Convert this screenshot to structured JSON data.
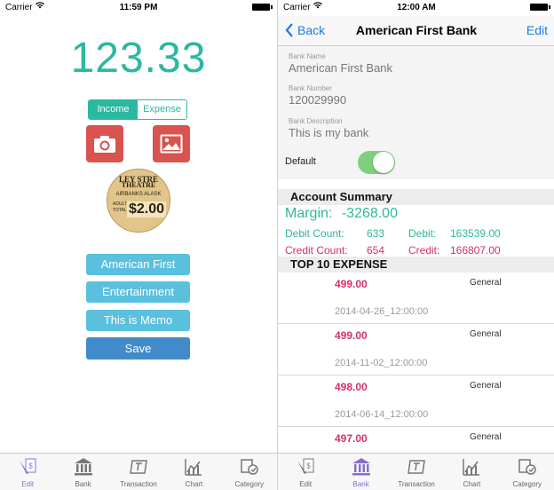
{
  "left": {
    "status": {
      "carrier": "Carrier",
      "time": "11:59 PM"
    },
    "amount": "123.33",
    "segment": {
      "income": "Income",
      "expense": "Expense",
      "selected": "Income"
    },
    "receipt": {
      "line1": "LEY STRE",
      "line2": "THEATRE",
      "line3": "AIRBANKS ALASK",
      "line4": "ADULT TOTAL",
      "line5": "$2.00"
    },
    "bank_button": "American First Bank",
    "category_button": "Entertainment",
    "memo_button": "This is Memo",
    "save_button": "Save",
    "tabs": [
      {
        "label": "Edit",
        "icon": "edit-icon"
      },
      {
        "label": "Bank",
        "icon": "bank-icon"
      },
      {
        "label": "Transaction",
        "icon": "transaction-icon"
      },
      {
        "label": "Chart",
        "icon": "chart-icon"
      },
      {
        "label": "Category",
        "icon": "category-icon"
      }
    ]
  },
  "right": {
    "status": {
      "carrier": "Carrier",
      "time": "12:00 AM"
    },
    "nav": {
      "back": "Back",
      "title": "American First Bank",
      "edit": "Edit"
    },
    "bank_name_label": "Bank Name",
    "bank_name": "American First Bank",
    "bank_number_label": "Bank Number",
    "bank_number": "120029990",
    "bank_desc_label": "Bank Description",
    "bank_desc": "This is my bank",
    "default_label": "Default",
    "default_on": true,
    "summary_title": "Account Summary",
    "margin_label": "Margin:",
    "margin_value": "-3268.00",
    "debit_count_label": "Debit Count:",
    "debit_count": "633",
    "debit_label": "Debit:",
    "debit_value": "163539.00",
    "credit_count_label": "Credit Count:",
    "credit_count": "654",
    "credit_label": "Credit:",
    "credit_value": "166807.00",
    "top_title": "TOP 10 EXPENSE",
    "expenses": [
      {
        "amount": "499.00",
        "category": "General",
        "date": "2014-04-26_12:00:00"
      },
      {
        "amount": "499.00",
        "category": "General",
        "date": "2014-11-02_12:00:00"
      },
      {
        "amount": "498.00",
        "category": "General",
        "date": "2014-06-14_12:00:00"
      },
      {
        "amount": "497.00",
        "category": "General",
        "date": ""
      }
    ],
    "tabs": [
      {
        "label": "Edit",
        "icon": "edit-icon"
      },
      {
        "label": "Bank",
        "icon": "bank-icon"
      },
      {
        "label": "Transaction",
        "icon": "transaction-icon"
      },
      {
        "label": "Chart",
        "icon": "chart-icon"
      },
      {
        "label": "Category",
        "icon": "category-icon"
      }
    ]
  },
  "colors": {
    "teal": "#2bb8a0",
    "red_button": "#d9534f",
    "info_button": "#5bc0de",
    "save": "#428bca",
    "ios_blue": "#1f7ae0",
    "pink": "#d4306c",
    "active_tab": "#8a6ecf"
  }
}
